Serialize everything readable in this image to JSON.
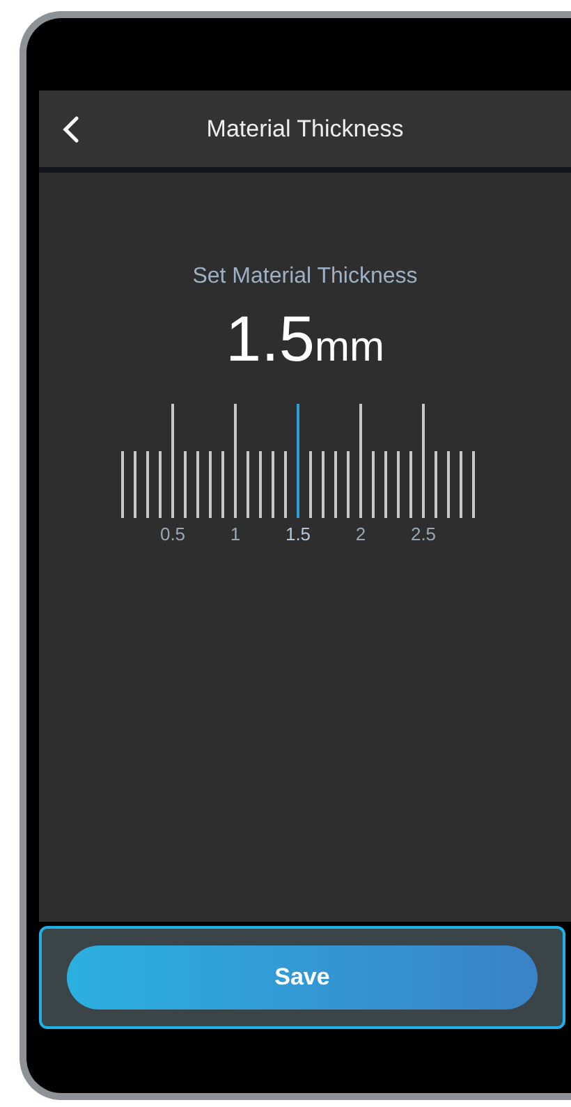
{
  "header": {
    "title": "Material Thickness"
  },
  "setting": {
    "label": "Set Material Thickness",
    "value": "1.5",
    "unit": "mm"
  },
  "scale": {
    "labels": [
      {
        "label": "0.5",
        "selected": false
      },
      {
        "label": "1",
        "selected": false
      },
      {
        "label": "1.5",
        "selected": true
      },
      {
        "label": "2",
        "selected": false
      },
      {
        "label": "2.5",
        "selected": false
      }
    ]
  },
  "footer": {
    "button": "Save"
  }
}
